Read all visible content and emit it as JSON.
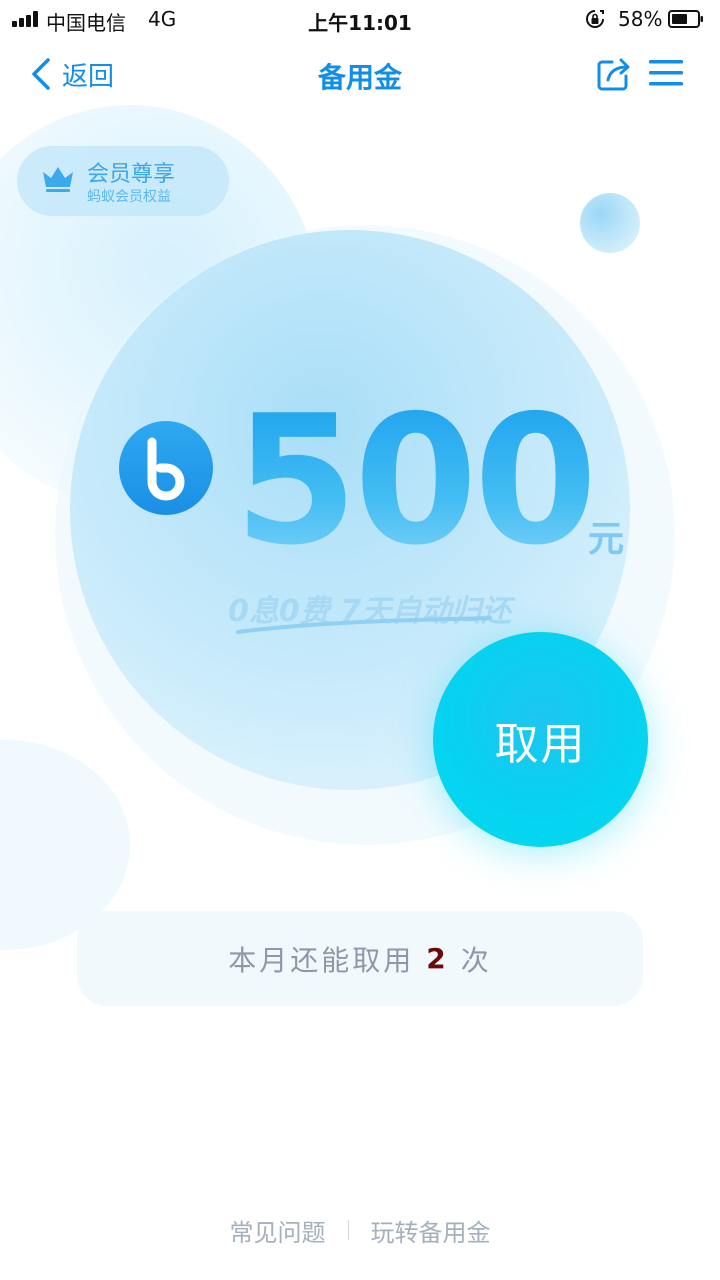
{
  "status_bar": {
    "carrier": "中国电信",
    "network": "4G",
    "time": "上午11:01",
    "battery": "58%"
  },
  "nav": {
    "back_label": "返回",
    "title": "备用金"
  },
  "member": {
    "title": "会员尊享",
    "subtitle": "蚂蚁会员权益"
  },
  "amount": {
    "value": "500",
    "unit": "元",
    "tagline": "0息0费  7天自动归还"
  },
  "action": {
    "withdraw_label": "取用"
  },
  "remaining": {
    "prefix": "本月还能取用",
    "count": "2",
    "suffix": "次"
  },
  "footer": {
    "faq": "常见问题",
    "guide": "玩转备用金"
  },
  "colors": {
    "primary": "#108ee9",
    "button": "#06d2f0",
    "count": "#6b0a0a"
  },
  "icons": {
    "back": "chevron-left-icon",
    "share": "share-icon",
    "menu": "hamburger-menu-icon",
    "crown": "crown-icon",
    "brand": "b-logo-icon"
  }
}
